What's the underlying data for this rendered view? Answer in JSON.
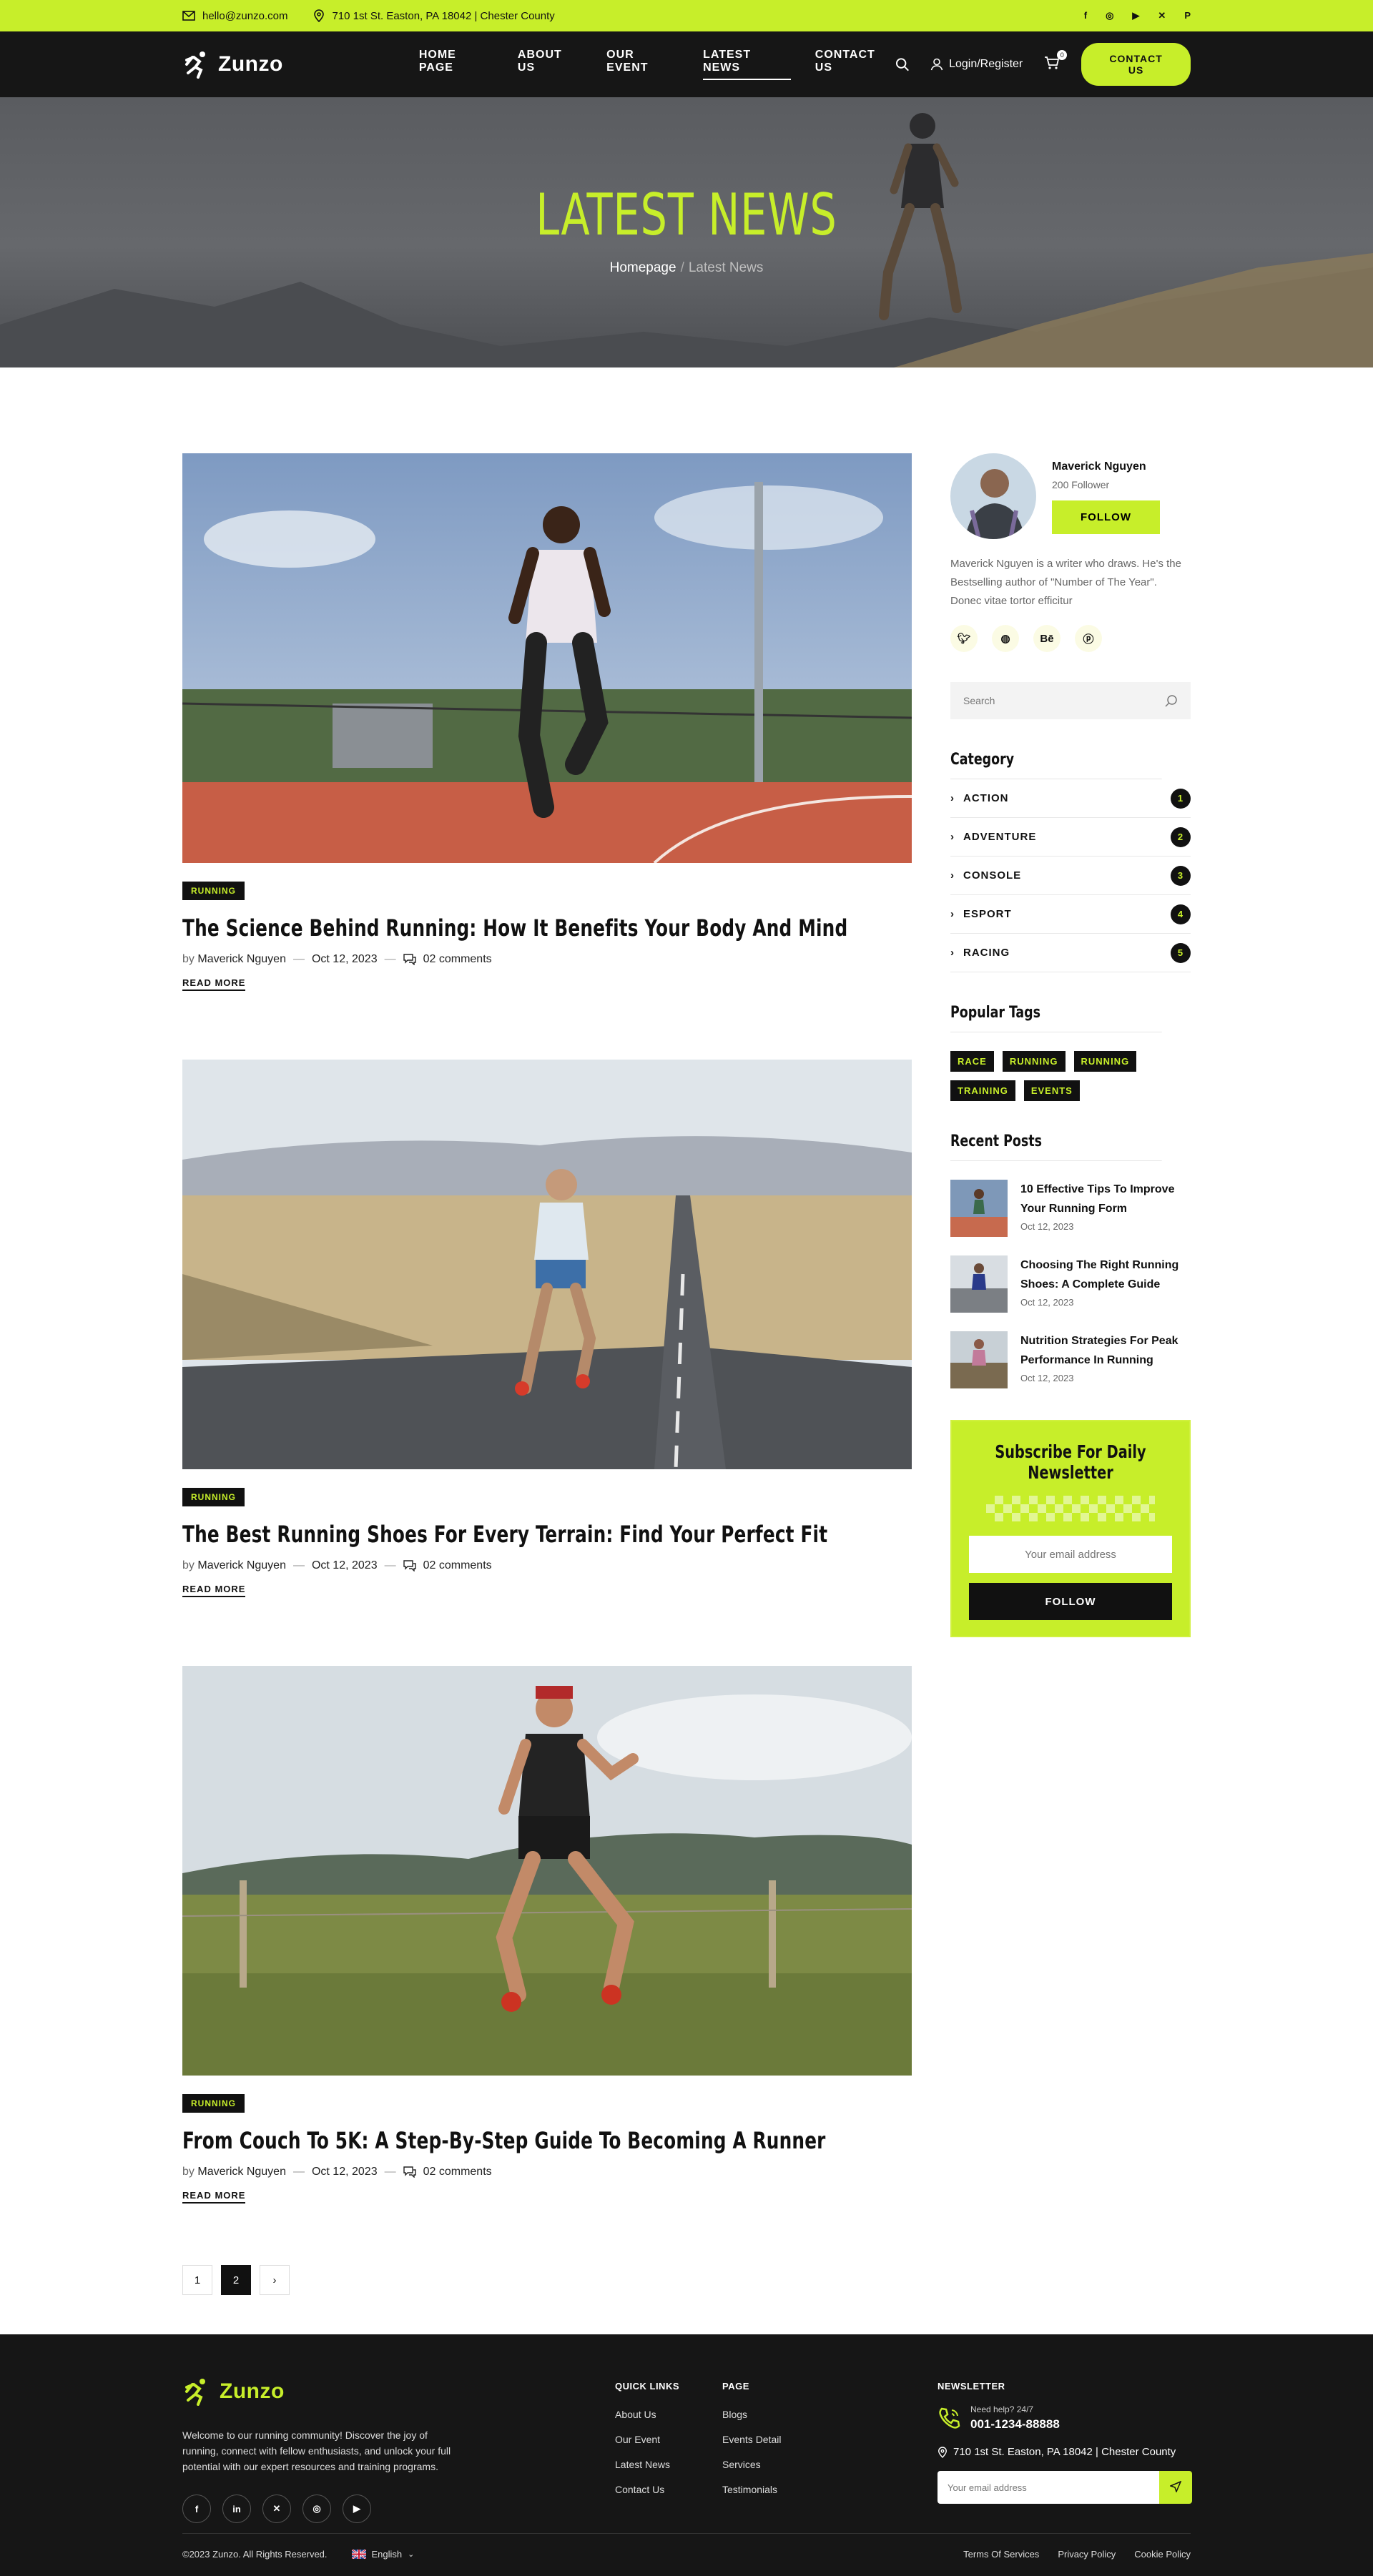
{
  "topbar": {
    "email": "hello@zunzo.com",
    "address": "710 1st St. Easton, PA 18042 | Chester County",
    "social": [
      "facebook-icon",
      "instagram-icon",
      "youtube-icon",
      "twitter-icon",
      "pinterest-icon"
    ]
  },
  "header": {
    "logo": "Zunzo",
    "nav": [
      "HOME PAGE",
      "ABOUT US",
      "OUR EVENT",
      "LATEST NEWS",
      "CONTACT US"
    ],
    "active_nav": "LATEST NEWS",
    "login": "Login/Register",
    "cart_count": "0",
    "contact_btn": "CONTACT US"
  },
  "hero": {
    "title": "LATEST NEWS",
    "crumb_home": "Homepage",
    "crumb_sep": "/",
    "crumb_current": "Latest News"
  },
  "posts": [
    {
      "tag": "RUNNING",
      "title": "The Science Behind Running: How It Benefits Your Body And Mind",
      "by": "by",
      "author": "Maverick Nguyen",
      "date": "Oct 12, 2023",
      "comments": "02 comments",
      "read_more": "READ MORE"
    },
    {
      "tag": "RUNNING",
      "title": "The Best Running Shoes For Every Terrain: Find Your Perfect Fit",
      "by": "by",
      "author": "Maverick Nguyen",
      "date": "Oct 12, 2023",
      "comments": "02 comments",
      "read_more": "READ MORE"
    },
    {
      "tag": "RUNNING",
      "title": "From Couch To 5K: A Step-By-Step Guide To Becoming A Runner",
      "by": "by",
      "author": "Maverick Nguyen",
      "date": "Oct 12, 2023",
      "comments": "02 comments",
      "read_more": "READ MORE"
    }
  ],
  "pagination": {
    "pages": [
      "1",
      "2"
    ],
    "current": "2",
    "next": "›"
  },
  "sidebar": {
    "author": {
      "name": "Maverick Nguyen",
      "followers": "200 Follower",
      "follow_btn": "FOLLOW",
      "bio": "Maverick Nguyen is a writer who draws. He's the Bestselling author of \"Number of The Year\". Donec vitae tortor efficitur",
      "social": [
        "twitter-icon",
        "dribbble-icon",
        "behance-icon",
        "pinterest-icon"
      ]
    },
    "search_placeholder": "Search",
    "category_title": "Category",
    "categories": [
      {
        "name": "ACTION",
        "count": "1"
      },
      {
        "name": "ADVENTURE",
        "count": "2"
      },
      {
        "name": "CONSOLE",
        "count": "3"
      },
      {
        "name": "ESPORT",
        "count": "4"
      },
      {
        "name": "RACING",
        "count": "5"
      }
    ],
    "tags_title": "Popular Tags",
    "tags": [
      "RACE",
      "RUNNING",
      "RUNNING",
      "TRAINING",
      "EVENTS"
    ],
    "recent_title": "Recent Posts",
    "recent": [
      {
        "title": "10 Effective Tips To Improve Your Running Form",
        "date": "Oct 12, 2023"
      },
      {
        "title": "Choosing The Right Running Shoes: A Complete Guide",
        "date": "Oct 12, 2023"
      },
      {
        "title": "Nutrition Strategies For Peak Performance In Running",
        "date": "Oct 12, 2023"
      }
    ],
    "newsletter": {
      "title": "Subscribe For Daily Newsletter",
      "placeholder": "Your email address",
      "button": "FOLLOW"
    }
  },
  "footer": {
    "logo": "Zunzo",
    "description": "Welcome to our running community! Discover the joy of running, connect with fellow enthusiasts, and unlock your full potential with our expert resources and training programs.",
    "quick_links_title": "QUICK LINKS",
    "quick_links": [
      "About Us",
      "Our Event",
      "Latest News",
      "Contact Us"
    ],
    "page_title": "PAGE",
    "page_links": [
      "Blogs",
      "Events Detail",
      "Services",
      "Testimonials"
    ],
    "newsletter_title": "NEWSLETTER",
    "help_label": "Need help? 24/7",
    "phone": "001-1234-88888",
    "address": "710 1st St. Easton, PA 18042 | Chester County",
    "email_placeholder": "Your email address",
    "copyright": "©2023 Zunzo. All Rights Reserved.",
    "language": "English",
    "bottom_links": [
      "Terms Of Services",
      "Privacy Policy",
      "Cookie Policy"
    ]
  },
  "colors": {
    "accent": "#c7ee2a",
    "dark": "#161616"
  }
}
